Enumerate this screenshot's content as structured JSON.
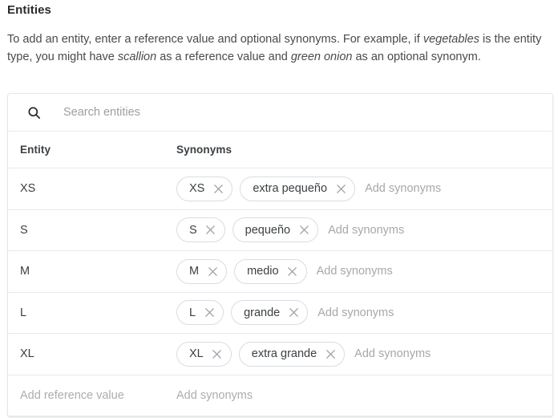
{
  "section": {
    "title": "Entities",
    "description_parts": [
      {
        "text": "To add an entity, enter a reference value and optional synonyms. For example, if ",
        "italic": false
      },
      {
        "text": "vegetables",
        "italic": true
      },
      {
        "text": " is the entity type, you might have ",
        "italic": false
      },
      {
        "text": "scallion",
        "italic": true
      },
      {
        "text": " as a reference value and ",
        "italic": false
      },
      {
        "text": "green onion",
        "italic": true
      },
      {
        "text": " as an optional synonym.",
        "italic": false
      }
    ]
  },
  "search": {
    "icon": "search-icon",
    "placeholder": "Search entities",
    "value": ""
  },
  "table": {
    "columns": [
      "Entity",
      "Synonyms"
    ],
    "rows": [
      {
        "entity": "XS",
        "synonyms": [
          "XS",
          "extra pequeño"
        ],
        "add_synonyms_placeholder": "Add synonyms"
      },
      {
        "entity": "S",
        "synonyms": [
          "S",
          "pequeño"
        ],
        "add_synonyms_placeholder": "Add synonyms"
      },
      {
        "entity": "M",
        "synonyms": [
          "M",
          "medio"
        ],
        "add_synonyms_placeholder": "Add synonyms"
      },
      {
        "entity": "L",
        "synonyms": [
          "L",
          "grande"
        ],
        "add_synonyms_placeholder": "Add synonyms"
      },
      {
        "entity": "XL",
        "synonyms": [
          "XL",
          "extra grande"
        ],
        "add_synonyms_placeholder": "Add synonyms"
      }
    ],
    "add_row": {
      "reference_placeholder": "Add reference value",
      "synonyms_placeholder": "Add synonyms"
    }
  },
  "colors": {
    "text_primary": "#3c4043",
    "text_heading": "#2b2b2b",
    "placeholder": "#a5a8ab",
    "border": "#e8eaed",
    "chip_border": "#dadce0",
    "chip_close": "#9aa0a6",
    "card_bg": "#ffffff"
  }
}
